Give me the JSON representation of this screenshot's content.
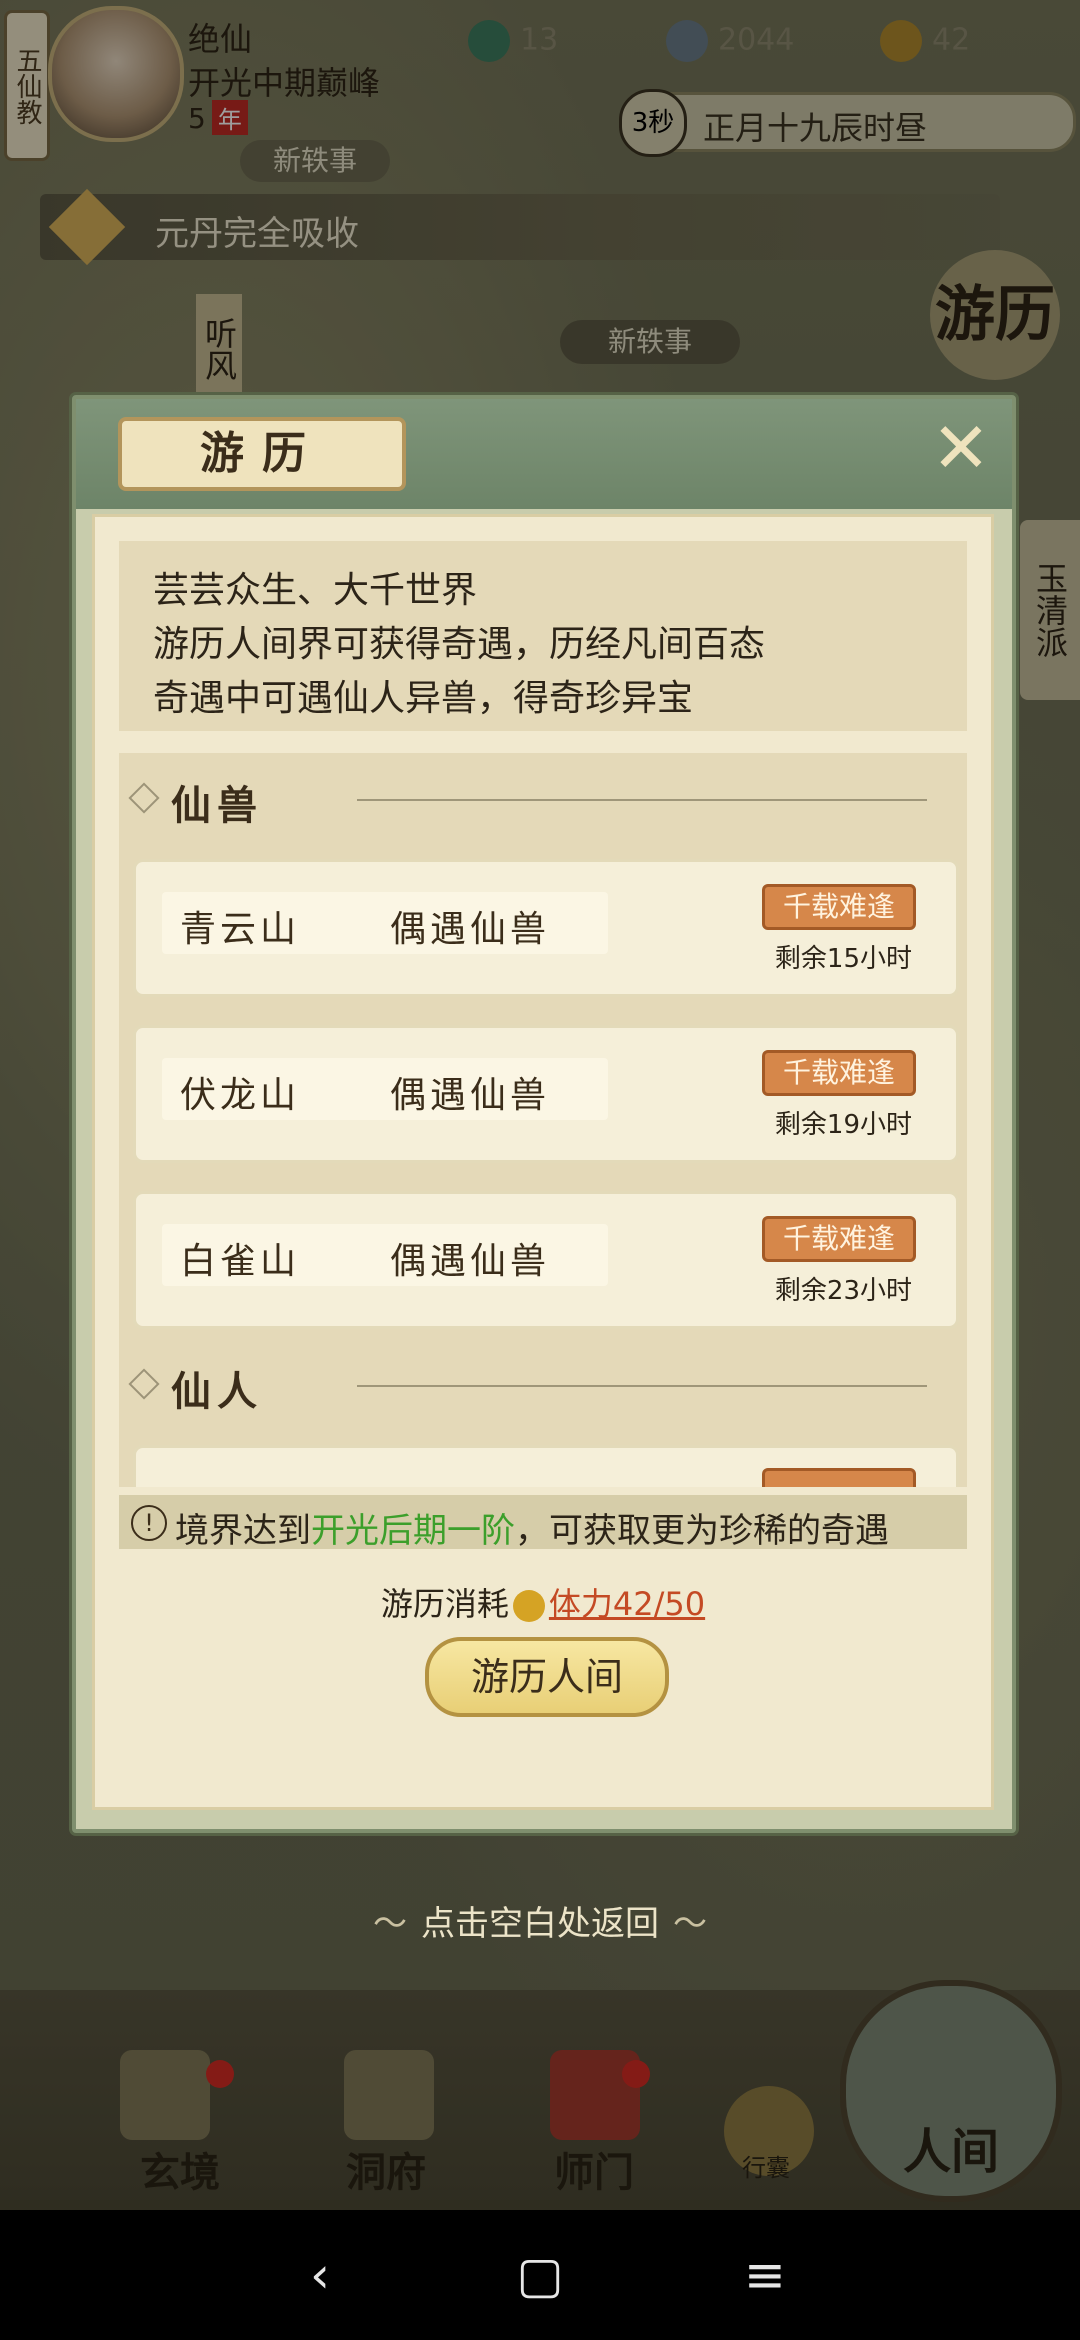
{
  "player": {
    "sect": "五仙教",
    "name": "绝仙",
    "realm": "开光中期巅峰",
    "age_num": "5",
    "age_unit": "年"
  },
  "resources": [
    {
      "icon": "jade-ring-icon",
      "value": "13"
    },
    {
      "icon": "coin-icon",
      "value": "2044"
    },
    {
      "icon": "strength-icon",
      "value": "42"
    }
  ],
  "time": {
    "countdown": "3秒",
    "date": "正月十九辰时昼"
  },
  "tags": {
    "new_story": "新轶事",
    "new_story_2": "新轶事",
    "tingfeng": "听风",
    "yuqing": "玉清派",
    "youli_badge": "游历"
  },
  "notice": "元丹完全吸收",
  "modal": {
    "title": "游历",
    "description": [
      "芸芸众生、大千世界",
      "游历人间界可获得奇遇，历经凡间百态",
      "奇遇中可遇仙人异兽，得奇珍异宝"
    ],
    "sections": [
      {
        "label": "仙兽",
        "rows": [
          {
            "place": "青云山",
            "event": "偶遇仙兽",
            "badge": "千载难逢",
            "remain": "剩余15小时"
          },
          {
            "place": "伏龙山",
            "event": "偶遇仙兽",
            "badge": "千载难逢",
            "remain": "剩余19小时"
          },
          {
            "place": "白雀山",
            "event": "偶遇仙兽",
            "badge": "千载难逢",
            "remain": "剩余23小时"
          }
        ]
      },
      {
        "label": "仙人"
      }
    ],
    "hint": {
      "prefix": "境界达到",
      "highlight": "开光后期一阶",
      "suffix": "，可获取更为珍稀的奇遇"
    },
    "cost": {
      "label": "游历消耗",
      "stamina": "体力42/50"
    },
    "button": "游历人间"
  },
  "return_hint": "点击空白处返回",
  "bottom_nav": [
    {
      "label": "玄境"
    },
    {
      "label": "洞府"
    },
    {
      "label": "师门"
    },
    {
      "label": "行囊"
    },
    {
      "label": "人间"
    }
  ],
  "colors": {
    "accent_green": "#3c9f2b",
    "badge_orange": "#d6874a",
    "stamina_red": "#c44a24"
  }
}
